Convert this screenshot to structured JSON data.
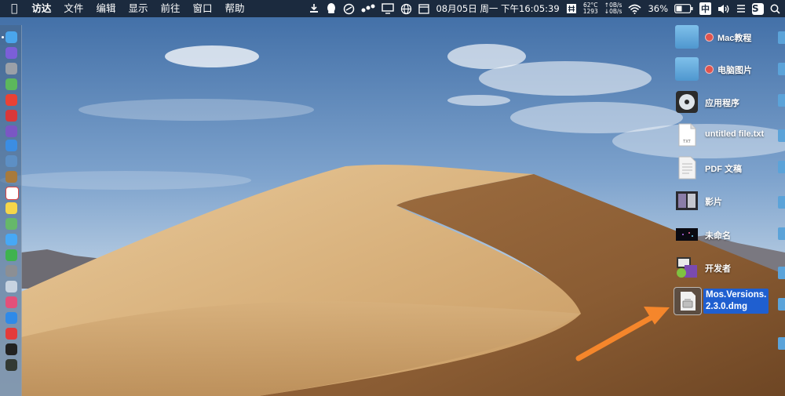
{
  "menubar": {
    "apple_label": "",
    "app_name": "访达",
    "menus": [
      "文件",
      "编辑",
      "显示",
      "前往",
      "窗口",
      "帮助"
    ],
    "status": {
      "datetime": "08月05日 周一 下午16:05:39",
      "temp": "62°C",
      "fan": "1293",
      "net_up": "↑0B/s",
      "net_down": "↓0B/s",
      "battery": "36%",
      "ime": "中",
      "s_app": "S"
    }
  },
  "dock": {
    "icons": [
      {
        "name": "finder-icon",
        "color": "#4aa6ec"
      },
      {
        "name": "siri-icon",
        "color": "#7b5fd8"
      },
      {
        "name": "launchpad-icon",
        "color": "#9aa0a8"
      },
      {
        "name": "android-icon",
        "color": "#5cb85c"
      },
      {
        "name": "chrome-icon",
        "color": "#e94235"
      },
      {
        "name": "app-red-icon",
        "color": "#d9383a"
      },
      {
        "name": "floppy-icon",
        "color": "#7a57c4"
      },
      {
        "name": "safari-icon",
        "color": "#3b8de3"
      },
      {
        "name": "preview-icon",
        "color": "#5d8fc4"
      },
      {
        "name": "notebook-icon",
        "color": "#a87a3c"
      },
      {
        "name": "calendar-icon",
        "color": "#ffffff"
      },
      {
        "name": "notes-icon",
        "color": "#f5d64a"
      },
      {
        "name": "maps-icon",
        "color": "#66b86a"
      },
      {
        "name": "messages-icon",
        "color": "#47a8f5"
      },
      {
        "name": "wechat-icon",
        "color": "#3fb34f"
      },
      {
        "name": "system-preferences-icon",
        "color": "#8c8f94"
      },
      {
        "name": "downloads-icon",
        "color": "#c7d3e0"
      },
      {
        "name": "itunes-icon",
        "color": "#e3507a"
      },
      {
        "name": "app-store-icon",
        "color": "#2f8ae8"
      },
      {
        "name": "vivaldi-icon",
        "color": "#e33b3b"
      },
      {
        "name": "terminal-icon",
        "color": "#222222"
      },
      {
        "name": "activity-monitor-icon",
        "color": "#333a33"
      }
    ]
  },
  "desktop": {
    "items": [
      {
        "label": "Mac教程",
        "type": "folder",
        "tag": true
      },
      {
        "label": "电脑图片",
        "type": "folder",
        "tag": true
      },
      {
        "label": "应用程序",
        "type": "app"
      },
      {
        "label": "untitled file.txt",
        "type": "txt",
        "badge": "TXT"
      },
      {
        "label": "PDF 文稿",
        "type": "pdf"
      },
      {
        "label": "影片",
        "type": "movie"
      },
      {
        "label": "未命名",
        "type": "image"
      },
      {
        "label": "开发者",
        "type": "dev"
      }
    ],
    "selected": {
      "line1": "Mos.Versions.",
      "line2": "2.3.0.dmg"
    }
  }
}
